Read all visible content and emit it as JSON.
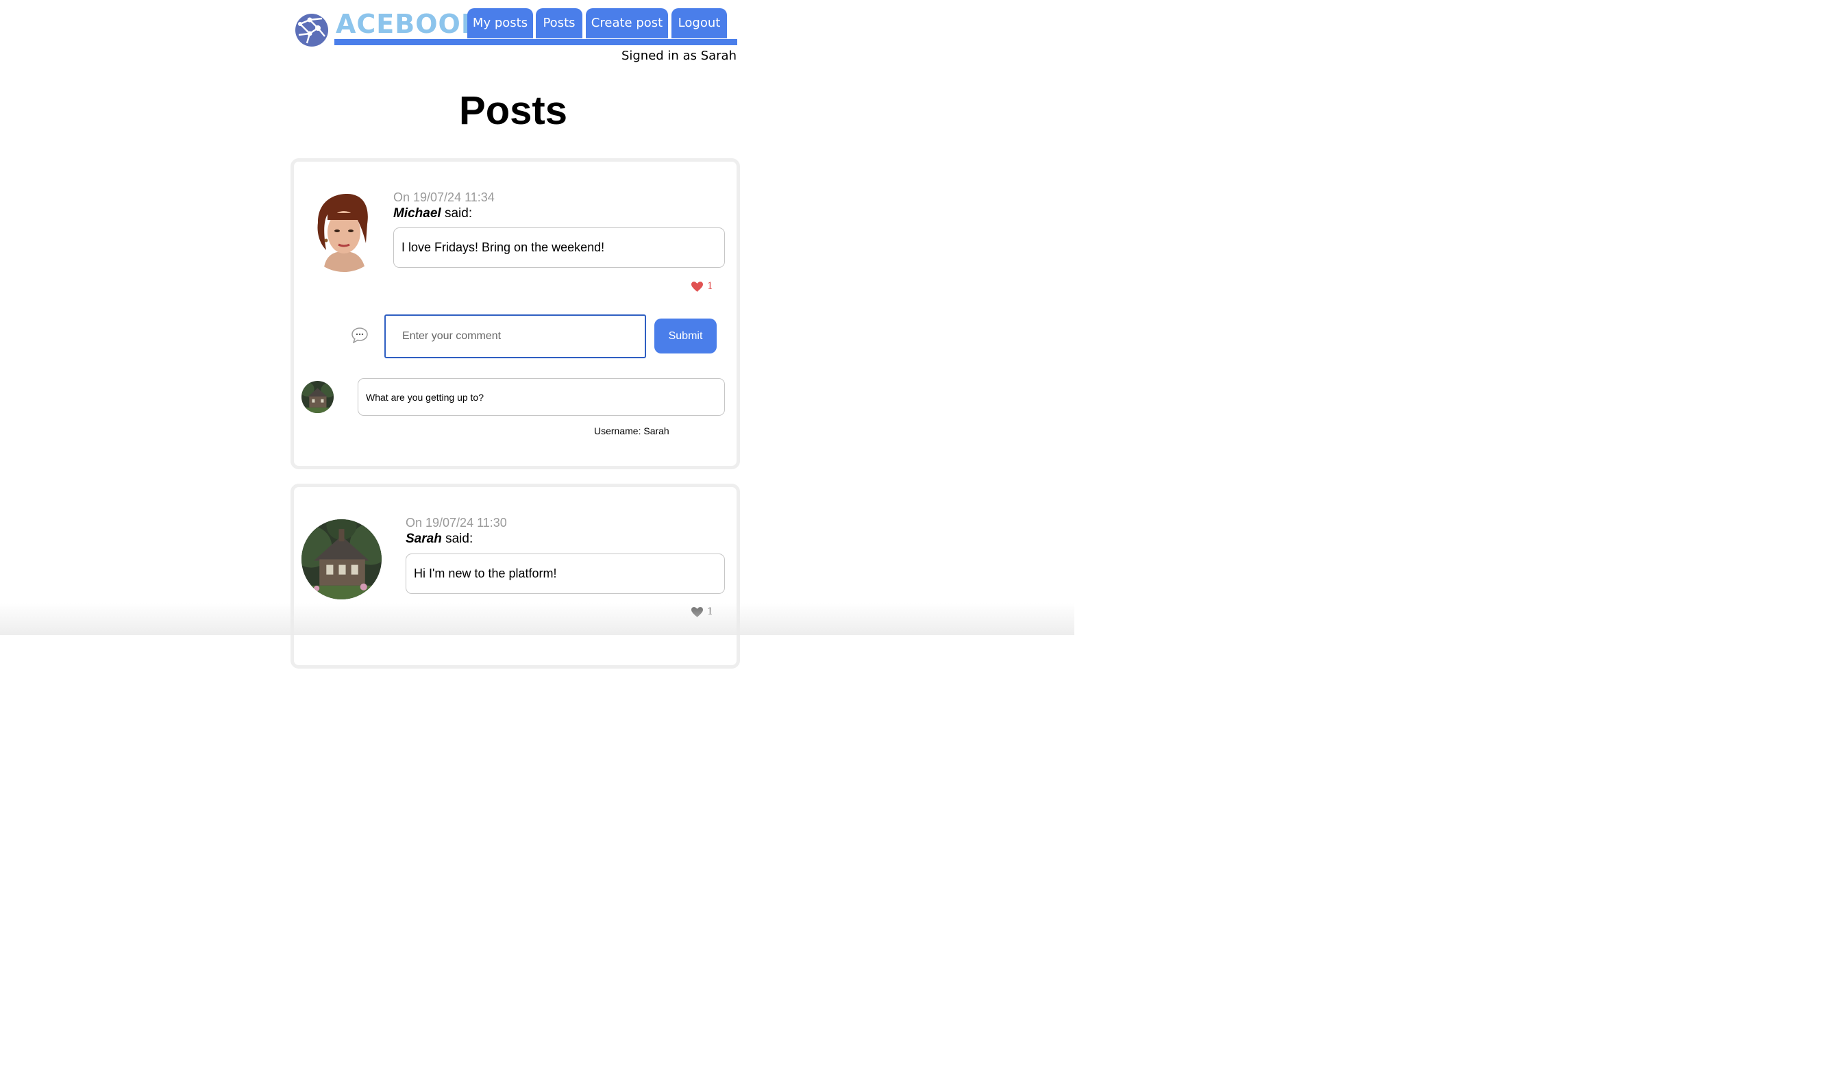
{
  "header": {
    "brand": "ACEBOOK",
    "nav": [
      "My posts",
      "Posts",
      "Create post",
      "Logout"
    ],
    "signed_in": "Signed in as Sarah"
  },
  "page_title": "Posts",
  "colors": {
    "accent": "#4a7eea",
    "brand_text": "#8cc4ec",
    "like_active": "#e05252",
    "like_inactive": "#666666"
  },
  "posts": [
    {
      "date": "On 19/07/24 11:34",
      "author": "Michael",
      "said": "said:",
      "message": "I love Fridays! Bring on the weekend!",
      "likes": "1",
      "liked": true,
      "comment_form": {
        "placeholder": "Enter your comment",
        "submit": "Submit"
      },
      "comments": [
        {
          "text": "What are you getting up to?",
          "username": "Username: Sarah"
        }
      ]
    },
    {
      "date": "On 19/07/24 11:30",
      "author": "Sarah",
      "said": "said:",
      "message": "Hi I'm new to the platform!",
      "likes": "1",
      "liked": false
    }
  ]
}
